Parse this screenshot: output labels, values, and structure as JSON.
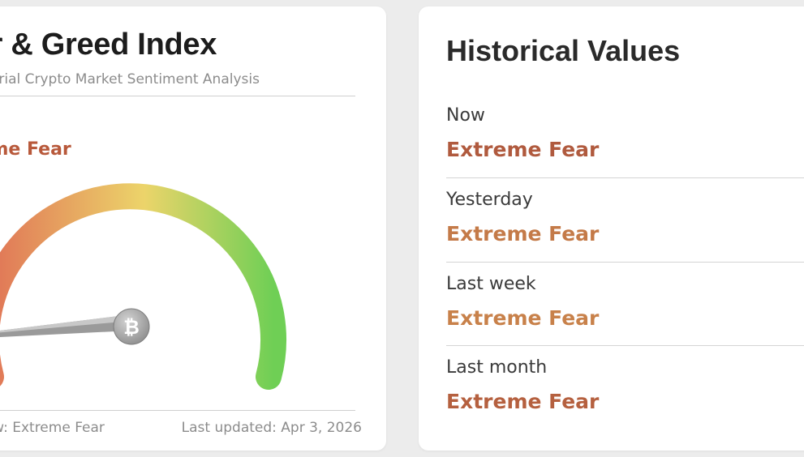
{
  "index_card": {
    "title": "Fear & Greed Index",
    "subtitle": "Multifactorial Crypto Market Sentiment Analysis",
    "sentiment": "Extreme Fear",
    "footer_left": "Now: Extreme Fear",
    "last_updated": "Last updated: Apr 3, 2026",
    "gauge_icon": "bitcoin-icon"
  },
  "historical": {
    "title": "Historical Values",
    "rows": [
      {
        "label": "Now",
        "value": "Extreme Fear",
        "color": "#b05a3e"
      },
      {
        "label": "Yesterday",
        "value": "Extreme Fear",
        "color": "#c47a48"
      },
      {
        "label": "Last week",
        "value": "Extreme Fear",
        "color": "#c8814a"
      },
      {
        "label": "Last month",
        "value": "Extreme Fear",
        "color": "#b5603f"
      }
    ]
  },
  "colors": {
    "fear": "#b8593b",
    "gauge_start": "#e07256",
    "gauge_mid": "#ecd46a",
    "gauge_end": "#6fcf55",
    "needle": "#9a9a9a"
  }
}
